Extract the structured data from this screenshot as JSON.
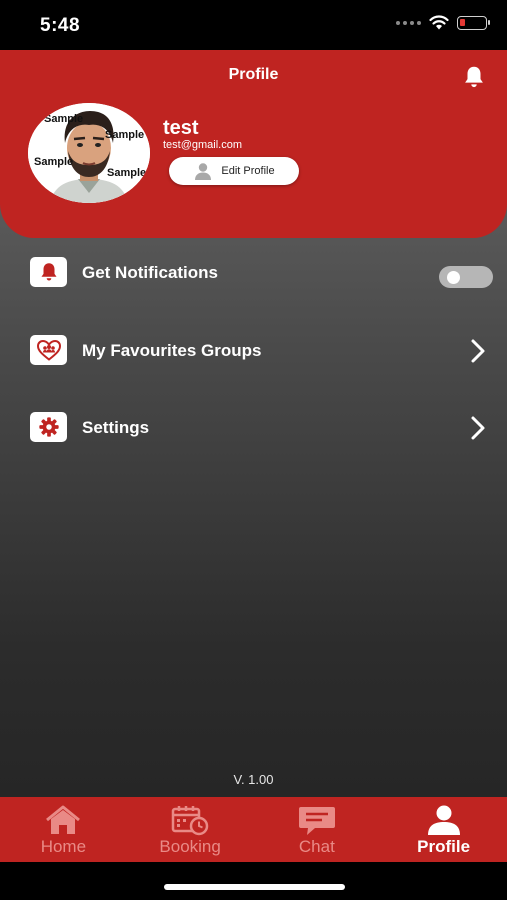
{
  "status_bar": {
    "time": "5:48",
    "battery_level": 0.2
  },
  "header": {
    "title": "Profile",
    "bell_icon": "bell-icon"
  },
  "profile": {
    "name": "test",
    "email": "test@gmail.com",
    "edit_button_label": "Edit Profile",
    "avatar_watermark": "Sample"
  },
  "menu": {
    "items": [
      {
        "label": "Get Notifications",
        "icon": "bell-icon",
        "control": "toggle",
        "enabled": false
      },
      {
        "label": "My Favourites Groups",
        "icon": "heart-group-icon",
        "control": "chevron"
      },
      {
        "label": "Settings",
        "icon": "gear-icon",
        "control": "chevron"
      }
    ]
  },
  "version": "V. 1.00",
  "tabs": [
    {
      "label": "Home",
      "icon": "home-icon",
      "active": false
    },
    {
      "label": "Booking",
      "icon": "calendar-icon",
      "active": false
    },
    {
      "label": "Chat",
      "icon": "chat-icon",
      "active": false
    },
    {
      "label": "Profile",
      "icon": "user-icon",
      "active": true
    }
  ],
  "colors": {
    "brand_red": "#bf2421",
    "inactive_tab": "#e98a86",
    "active_tab": "#ffffff",
    "toggle_off": "#b6b6b6"
  }
}
